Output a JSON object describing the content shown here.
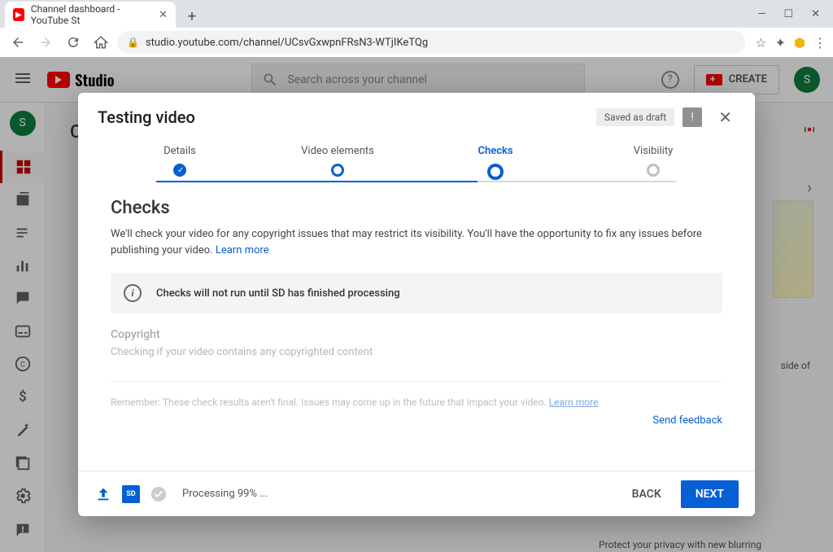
{
  "browser": {
    "tab_title": "Channel dashboard - YouTube St",
    "url": "studio.youtube.com/channel/UCsvGxwpnFRsN3-WTjIKeTQg"
  },
  "header": {
    "logo_text": "Studio",
    "search_placeholder": "Search across your channel",
    "create_label": "CREATE",
    "avatar_initial": "S"
  },
  "rail": {
    "avatar_initial": "S"
  },
  "bg": {
    "partial_heading": "C",
    "side_text": "side of",
    "privacy": "Protect your privacy with new blurring"
  },
  "modal": {
    "title": "Testing video",
    "draft_badge": "Saved as draft",
    "steps": {
      "details": "Details",
      "elements": "Video elements",
      "checks": "Checks",
      "visibility": "Visibility"
    },
    "section_title": "Checks",
    "section_desc": "We'll check your video for any copyright issues that may restrict its visibility. You'll have the opportunity to fix any issues before publishing your video. ",
    "learn_more": "Learn more",
    "notice": "Checks will not run until SD has finished processing",
    "copyright_title": "Copyright",
    "copyright_desc": "Checking if your video contains any copyrighted content",
    "remember": "Remember: These check results aren't final. Issues may come up in the future that impact your video. ",
    "send_feedback": "Send feedback",
    "processing": "Processing 99% ...",
    "back": "BACK",
    "next": "NEXT"
  }
}
